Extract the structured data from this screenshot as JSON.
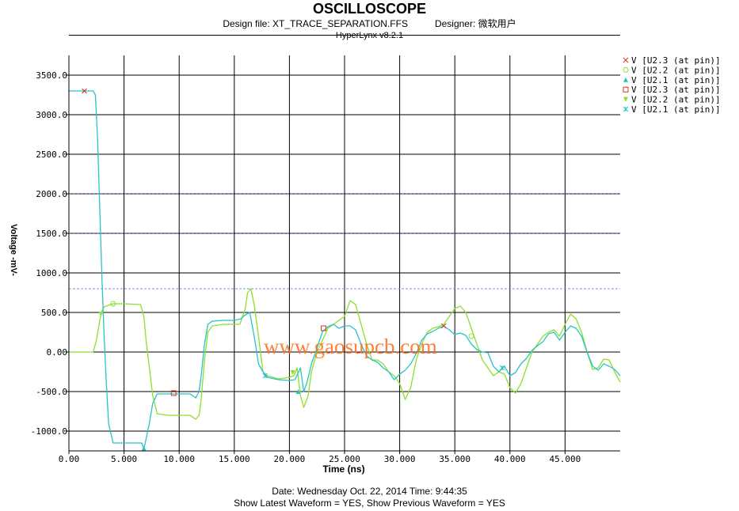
{
  "header": {
    "title": "OSCILLOSCOPE",
    "design_file": "Design file: XT_TRACE_SEPARATION.FFS",
    "designer": "Designer: 微软用户",
    "version": "HyperLynx v8.2.1"
  },
  "footer": {
    "date": "Date: Wednesday  Oct. 22, 2014   Time: 9:44:35",
    "waveform_flags": "Show Latest Waveform = YES,    Show Previous Waveform = YES"
  },
  "watermark": "www.gaosupcb.com",
  "colors": {
    "cyan": "#26c3c9",
    "green": "#8be02a",
    "guide": "#1e2d8c",
    "guide_light": "#8a8ad8",
    "watermark": "#ff6a1a"
  },
  "chart_data": {
    "type": "line",
    "xlabel": "Time (ns)",
    "ylabel": "Voltage -mV-",
    "xlim": [
      0,
      50
    ],
    "ylim": [
      -1250,
      3750
    ],
    "xticks": [
      0,
      5,
      10,
      15,
      20,
      25,
      30,
      35,
      40,
      45
    ],
    "xtick_labels": [
      "0.00",
      "5.000",
      "10.000",
      "15.000",
      "20.000",
      "25.000",
      "30.000",
      "35.000",
      "40.000",
      "45.000"
    ],
    "yticks": [
      3500,
      3000,
      2500,
      2000,
      1500,
      1000,
      500,
      0,
      -500,
      -1000
    ],
    "ytick_labels": [
      "3500.0",
      "3000.0",
      "2500.0",
      "2000.0",
      "1500.0",
      "1000.0",
      "500.0",
      "0.00",
      "-500.0",
      "-1000.0"
    ],
    "grid": true,
    "reference_lines": [
      2000,
      1500,
      800
    ],
    "legend_position": "right",
    "legend": [
      {
        "label": "V [U2.3 (at pin)]",
        "marker": "x",
        "color": "#e0301e"
      },
      {
        "label": "V [U2.2 (at pin)]",
        "marker": "o",
        "color": "#8be02a"
      },
      {
        "label": "V [U2.1 (at pin)]",
        "marker": "^",
        "color": "#26c3c9"
      },
      {
        "label": "V [U2.3 (at pin)]",
        "marker": "s",
        "color": "#e0301e"
      },
      {
        "label": "V [U2.2 (at pin)]",
        "marker": "v",
        "color": "#8be02a"
      },
      {
        "label": "V [U2.1 (at pin)]",
        "marker": "*",
        "color": "#26c3c9"
      }
    ],
    "series": [
      {
        "color": "#26c3c9",
        "x": [
          0,
          2.2,
          2.4,
          2.6,
          2.8,
          3.0,
          3.2,
          3.4,
          3.6,
          4.0,
          5.5,
          6.6,
          6.8,
          7.0,
          7.3,
          7.6,
          8.0,
          9.0,
          10.0,
          11.0,
          11.5,
          11.8,
          12.0,
          12.3,
          12.6,
          13.0,
          14.0,
          15.0,
          15.6,
          16.0,
          16.4,
          16.8,
          17.2,
          17.6,
          18.0,
          19.0,
          20.0,
          20.5,
          21.0,
          21.3,
          21.6,
          22.0,
          22.5,
          23.0,
          23.5,
          24.0,
          24.5,
          25.0,
          25.5,
          26.0,
          26.5,
          27.0,
          27.5,
          28.0,
          28.5,
          29.0,
          29.5,
          30.0,
          30.5,
          31.0,
          31.5,
          32.0,
          32.5,
          33.0,
          33.5,
          34.0,
          34.5,
          35.0,
          35.5,
          36.0,
          36.5,
          37.0,
          37.5,
          38.0,
          38.5,
          39.0,
          39.5,
          40.0,
          40.5,
          41.0,
          41.5,
          42.0,
          42.5,
          43.0,
          43.5,
          44.0,
          44.5,
          45.0,
          45.5,
          46.0,
          46.5,
          47.0,
          47.5,
          48.0,
          48.5,
          49.0,
          49.5,
          50.0
        ],
        "y": [
          3300,
          3300,
          3250,
          2700,
          1800,
          900,
          200,
          -400,
          -900,
          -1150,
          -1150,
          -1150,
          -1220,
          -1100,
          -900,
          -650,
          -530,
          -530,
          -530,
          -530,
          -580,
          -500,
          -300,
          100,
          350,
          390,
          400,
          400,
          420,
          470,
          500,
          200,
          -150,
          -250,
          -320,
          -350,
          -360,
          -350,
          -200,
          -500,
          -380,
          -150,
          50,
          260,
          320,
          350,
          300,
          330,
          330,
          280,
          100,
          -50,
          -100,
          -130,
          -200,
          -250,
          -350,
          -280,
          -230,
          -150,
          -20,
          150,
          230,
          260,
          300,
          330,
          280,
          220,
          240,
          210,
          100,
          30,
          0,
          -10,
          -180,
          -250,
          -180,
          -300,
          -260,
          -150,
          -80,
          20,
          80,
          130,
          230,
          250,
          150,
          250,
          330,
          300,
          200,
          0,
          -180,
          -230,
          -150,
          -180,
          -220,
          -300
        ]
      },
      {
        "color": "#8be02a",
        "x": [
          0,
          2.0,
          2.2,
          2.5,
          2.8,
          3.0,
          3.2,
          3.6,
          4.0,
          4.5,
          5.0,
          6.5,
          6.8,
          7.0,
          7.3,
          7.6,
          8.0,
          9.0,
          10.0,
          11.0,
          11.5,
          11.8,
          12.0,
          12.3,
          12.6,
          13.0,
          14.0,
          15.0,
          15.5,
          16.0,
          16.2,
          16.5,
          16.8,
          17.2,
          17.6,
          18.0,
          19.0,
          20.0,
          20.4,
          20.7,
          21.0,
          21.3,
          21.7,
          22.0,
          22.5,
          23.0,
          23.5,
          24.0,
          24.5,
          25.0,
          25.5,
          26.0,
          26.5,
          27.0,
          27.5,
          28.0,
          28.5,
          29.0,
          29.5,
          30.0,
          30.5,
          31.0,
          31.5,
          32.0,
          32.5,
          33.0,
          33.5,
          34.0,
          34.5,
          35.0,
          35.5,
          36.0,
          36.5,
          37.0,
          37.5,
          38.0,
          38.5,
          39.0,
          39.5,
          40.0,
          40.5,
          41.0,
          41.5,
          42.0,
          42.5,
          43.0,
          43.5,
          44.0,
          44.5,
          45.0,
          45.5,
          46.0,
          46.5,
          47.0,
          47.5,
          48.0,
          48.5,
          49.0,
          49.5,
          50.0
        ],
        "y": [
          0,
          0,
          0,
          150,
          400,
          520,
          570,
          590,
          610,
          610,
          610,
          600,
          450,
          150,
          -200,
          -550,
          -780,
          -800,
          -800,
          -800,
          -850,
          -800,
          -600,
          -100,
          250,
          330,
          350,
          350,
          350,
          550,
          750,
          800,
          600,
          200,
          -250,
          -300,
          -340,
          -320,
          -300,
          -200,
          -550,
          -700,
          -550,
          -250,
          0,
          150,
          300,
          350,
          400,
          450,
          650,
          600,
          350,
          100,
          -100,
          -100,
          -150,
          -250,
          -300,
          -400,
          -600,
          -450,
          -100,
          100,
          250,
          300,
          320,
          350,
          450,
          550,
          580,
          500,
          300,
          100,
          -100,
          -200,
          -300,
          -250,
          -280,
          -450,
          -520,
          -400,
          -200,
          0,
          100,
          200,
          250,
          280,
          200,
          350,
          480,
          420,
          250,
          0,
          -220,
          -200,
          -90,
          -100,
          -250,
          -380
        ]
      }
    ],
    "markers": [
      {
        "series_marker": "x",
        "x": 1.4,
        "y": 3300,
        "color": "#e0301e"
      },
      {
        "series_marker": "o",
        "x": 4.0,
        "y": 610,
        "color": "#8be02a"
      },
      {
        "series_marker": "^",
        "x": 6.8,
        "y": -1220,
        "color": "#26c3c9"
      },
      {
        "series_marker": "s",
        "x": 9.5,
        "y": -520,
        "color": "#e0301e"
      },
      {
        "series_marker": "v",
        "x": 2.9,
        "y": 480,
        "color": "#8be02a"
      },
      {
        "series_marker": "*",
        "x": 17.8,
        "y": -300,
        "color": "#26c3c9"
      },
      {
        "series_marker": "x",
        "x": 34.0,
        "y": 330,
        "color": "#e0301e"
      },
      {
        "series_marker": "o",
        "x": 36.5,
        "y": 200,
        "color": "#8be02a"
      },
      {
        "series_marker": "^",
        "x": 20.8,
        "y": -500,
        "color": "#26c3c9"
      },
      {
        "series_marker": "v",
        "x": 20.3,
        "y": -260,
        "color": "#8be02a"
      },
      {
        "series_marker": "*",
        "x": 39.3,
        "y": -200,
        "color": "#26c3c9"
      },
      {
        "series_marker": "s",
        "x": 23.1,
        "y": 300,
        "color": "#e0301e"
      }
    ]
  }
}
